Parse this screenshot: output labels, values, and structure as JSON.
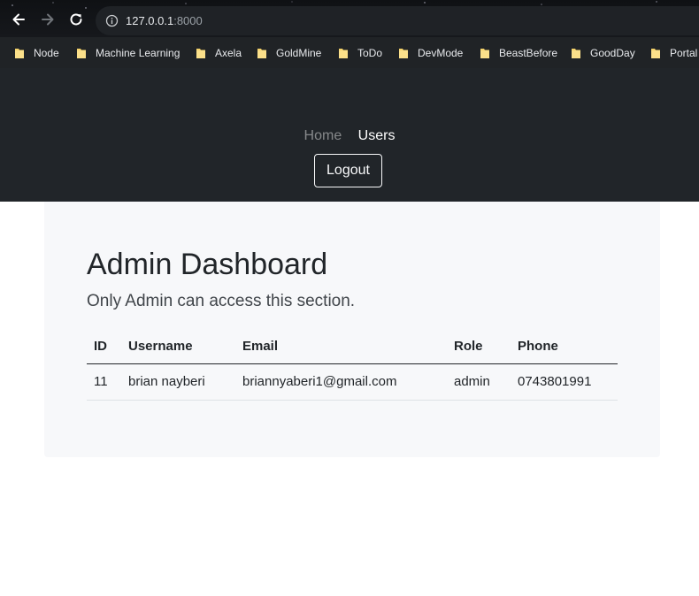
{
  "browser": {
    "url_host": "127.0.0.1",
    "url_port": ":8000",
    "bookmarks": [
      "Node",
      "Machine Learning",
      "Axela",
      "GoldMine",
      "ToDo",
      "DevMode",
      "BeastBefore",
      "GoodDay",
      "Portal"
    ]
  },
  "navbar": {
    "links": [
      "Home",
      "Users"
    ],
    "logout_label": "Logout"
  },
  "main": {
    "title": "Admin Dashboard",
    "subtitle": "Only Admin can access this section.",
    "table": {
      "columns": [
        "ID",
        "Username",
        "Email",
        "Role",
        "Phone"
      ],
      "rows": [
        [
          "11",
          "brian nayberi",
          "briannyaberi1@gmail.com",
          "admin",
          "0743801991"
        ]
      ]
    }
  },
  "colors": {
    "navbar_bg": "#212529",
    "card_bg": "#f7f8fa",
    "folder": "#f5d36b"
  }
}
